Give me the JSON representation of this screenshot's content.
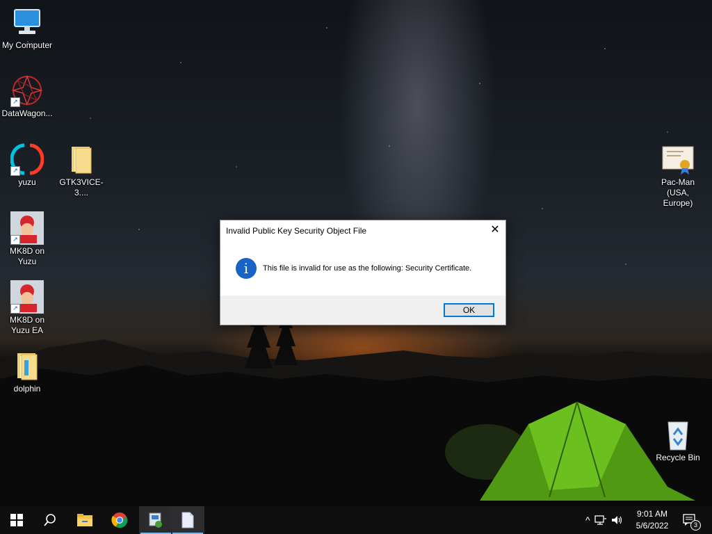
{
  "desktop": {
    "icons": [
      {
        "label": "My Computer",
        "icon": "computer-icon"
      },
      {
        "label": "DataWagon...",
        "icon": "datawagon-icon"
      },
      {
        "label": "yuzu",
        "icon": "yuzu-icon"
      },
      {
        "label": "GTK3VICE-3....",
        "icon": "folder-icon"
      },
      {
        "label": "MK8D on Yuzu",
        "icon": "mario-kart-icon"
      },
      {
        "label": "MK8D on Yuzu EA",
        "icon": "mario-kart-icon"
      },
      {
        "label": "dolphin",
        "icon": "folder-icon"
      },
      {
        "label": "Pac-Man (USA, Europe)",
        "icon": "certificate-icon"
      },
      {
        "label": "Recycle Bin",
        "icon": "recycle-bin-icon"
      }
    ]
  },
  "dialog": {
    "title": "Invalid Public Key Security Object File",
    "close_glyph": "✕",
    "icon": "info-icon",
    "info_glyph": "i",
    "message": "This file is invalid for use as the following: Security Certificate.",
    "ok_label": "OK"
  },
  "taskbar": {
    "buttons": [
      {
        "name": "start",
        "icon": "windows-logo-icon"
      },
      {
        "name": "search",
        "icon": "search-icon"
      },
      {
        "name": "file-explorer",
        "icon": "folder-icon"
      },
      {
        "name": "chrome",
        "icon": "chrome-icon"
      },
      {
        "name": "app",
        "icon": "app-icon"
      },
      {
        "name": "document",
        "icon": "document-icon"
      }
    ],
    "tray": {
      "chevron": "^",
      "time": "9:01 AM",
      "date": "5/6/2022",
      "notification_count": "3"
    }
  },
  "colors": {
    "accent": "#0078d7",
    "info": "#1a63c6",
    "taskbar": "#0f0f10"
  }
}
